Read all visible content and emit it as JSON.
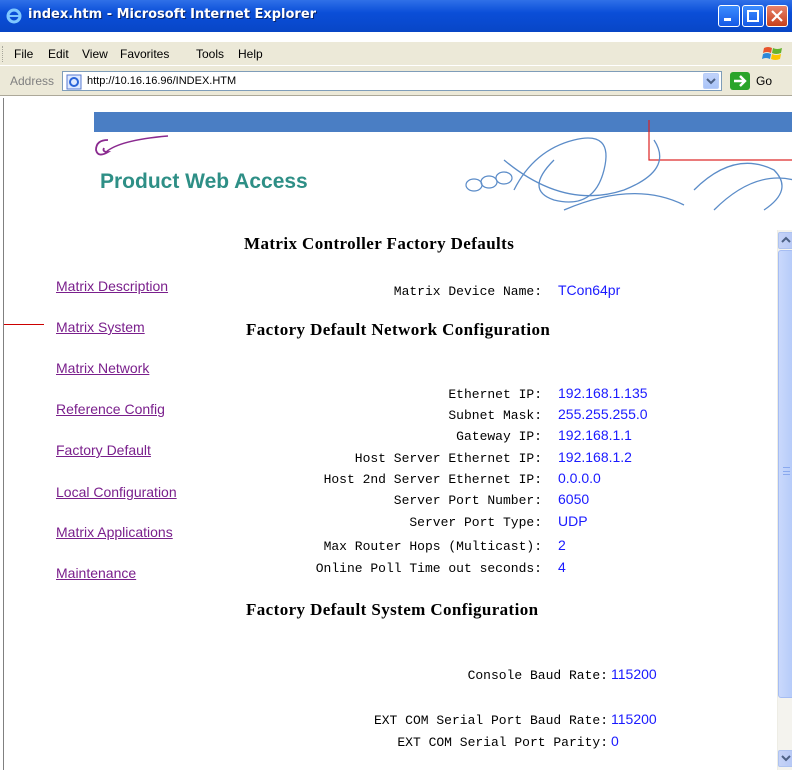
{
  "window": {
    "title": "index.htm - Microsoft Internet Explorer"
  },
  "menu": {
    "items": [
      "File",
      "Edit",
      "View",
      "Favorites",
      "Tools",
      "Help"
    ]
  },
  "address_bar": {
    "label": "Address",
    "url": "http://10.16.16.96/INDEX.HTM",
    "go_label": "Go"
  },
  "page": {
    "product_title": "Product Web Access",
    "nav_links": [
      "Matrix Description",
      "Matrix System",
      "Matrix Network",
      "Reference Config",
      "Factory Default",
      "Local Configuration",
      "Matrix Applications",
      "Maintenance"
    ],
    "main_heading": "Matrix Controller Factory Defaults",
    "device_name": {
      "label": "Matrix Device Name:",
      "value": "TCon64pr"
    },
    "network_heading": "Factory Default Network Configuration",
    "network": [
      {
        "label": "Ethernet IP:",
        "value": "192.168.1.135"
      },
      {
        "label": "Subnet Mask:",
        "value": "255.255.255.0"
      },
      {
        "label": "Gateway IP:",
        "value": "192.168.1.1"
      },
      {
        "label": "Host Server Ethernet IP:",
        "value": "192.168.1.2"
      },
      {
        "label": "Host 2nd Server Ethernet IP:",
        "value": "0.0.0.0"
      },
      {
        "label": "Server Port Number:",
        "value": "6050"
      },
      {
        "label": "Server Port Type:",
        "value": "UDP"
      },
      {
        "label": "Max Router Hops (Multicast):",
        "value": "2"
      },
      {
        "label": "Online Poll Time out seconds:",
        "value": "4"
      }
    ],
    "system_heading": "Factory Default System Configuration",
    "system": [
      {
        "label": "Console Baud Rate:",
        "value": "115200"
      },
      {
        "label": "EXT COM Serial Port Baud Rate:",
        "value": "115200"
      },
      {
        "label": "EXT COM Serial Port Parity:",
        "value": "0"
      }
    ]
  },
  "colors": {
    "title_bar": "#0a4ed8",
    "link": "#7a1f8c",
    "value": "#1a1aff",
    "product_title": "#2e8f86",
    "band": "#4a7ec4"
  }
}
